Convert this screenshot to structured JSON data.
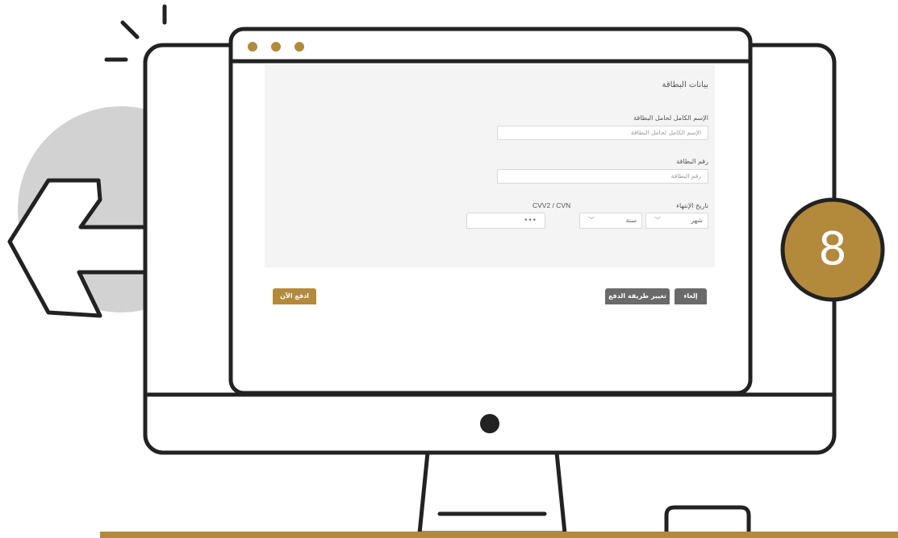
{
  "colors": {
    "gold": "#b38a3c",
    "outline": "#222222",
    "card_bg": "#f4f4f4",
    "arrow_circle": "#d2d2d2",
    "gray_button": "#6a6a6a"
  },
  "browser": {
    "window_dots": [
      "dot",
      "dot",
      "dot"
    ]
  },
  "form": {
    "title": "بيانات البطاقة",
    "cardholder": {
      "label": "الإسم الكامل لحامل البطاقة",
      "placeholder": "الإسم الكامل لحامل البطاقة"
    },
    "card_number": {
      "label": "رقم البطاقة",
      "placeholder": "رقم البطاقة"
    },
    "expiry": {
      "label": "تاريخ الإنتهاء",
      "month": "شهر",
      "year": "سنة"
    },
    "cvv": {
      "label": "CVV2 / CVN",
      "value": "•••"
    }
  },
  "buttons": {
    "pay_now": "ادفع الآن",
    "change_payment": "تغيير طريقة الدفع",
    "cancel": "إلغاء"
  },
  "step_badge": {
    "number": "8"
  },
  "icons": {
    "back_arrow": "back-arrow-icon",
    "sparkle": "sparkle-lines-icon",
    "chevron": "chevron-down-icon"
  }
}
